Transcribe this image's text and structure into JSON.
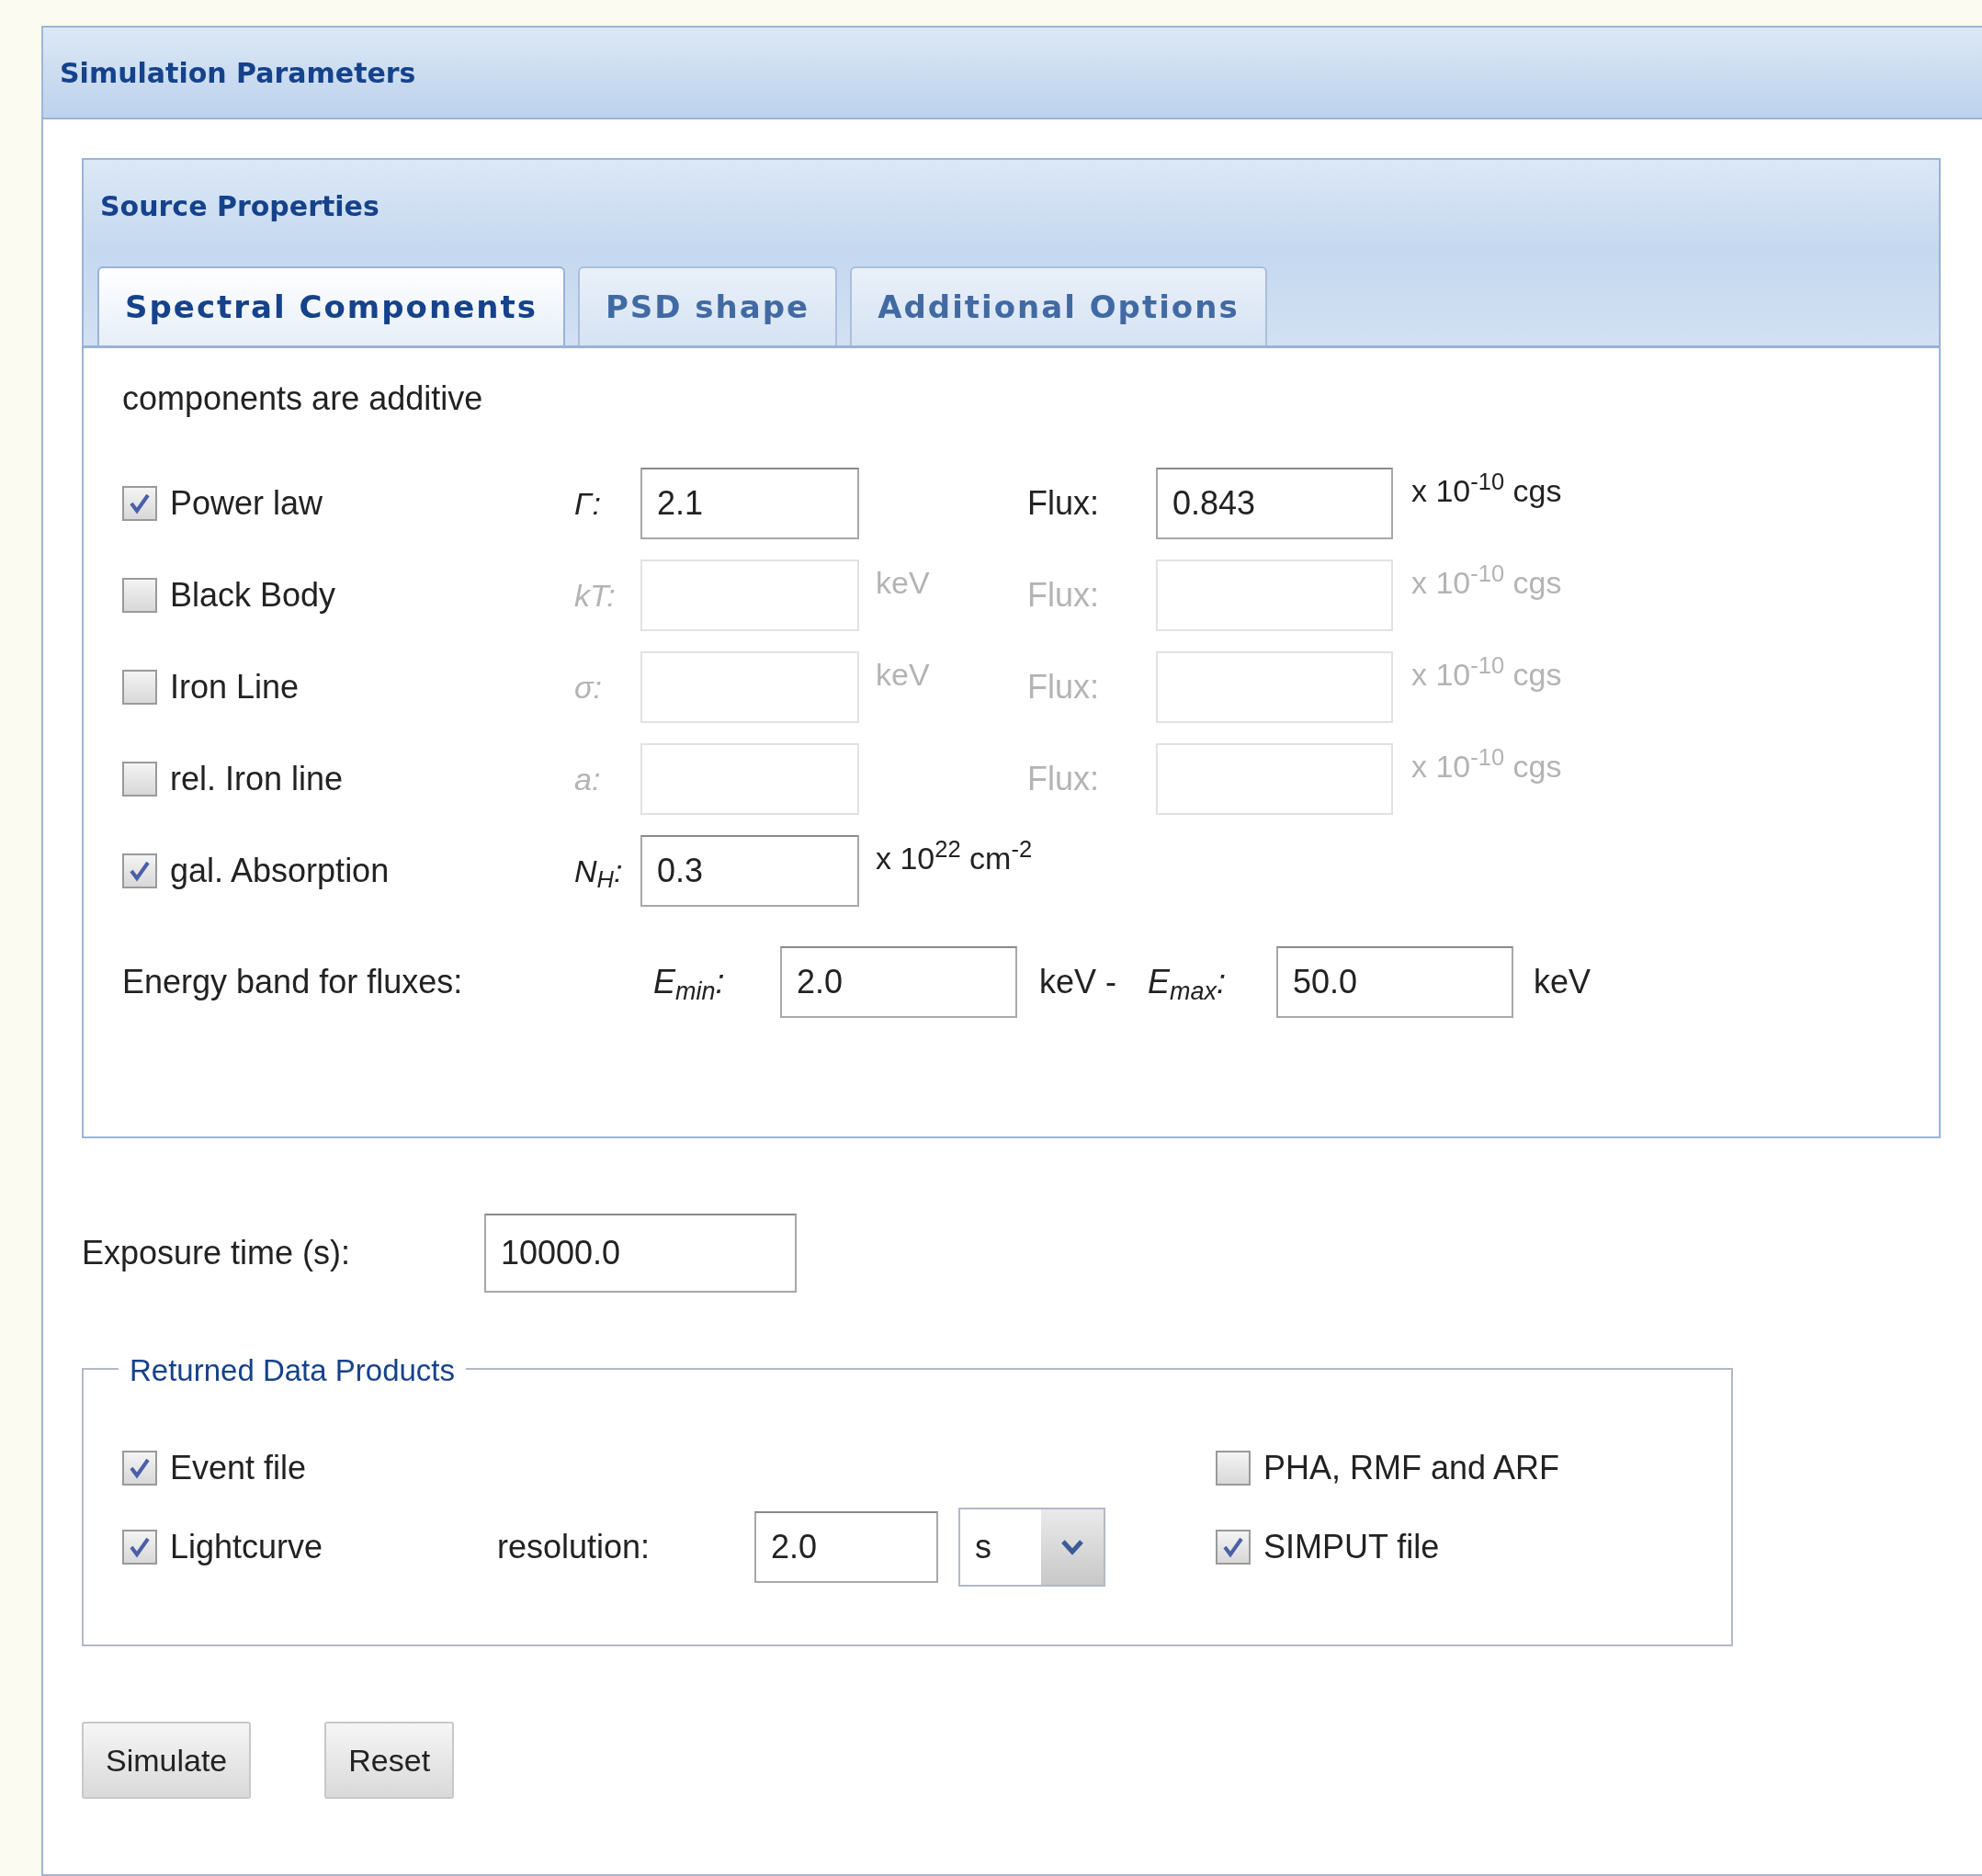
{
  "panel": {
    "title": "Simulation Parameters"
  },
  "source_properties": {
    "title": "Source Properties",
    "tabs": [
      {
        "label": "Spectral Components",
        "selected": true
      },
      {
        "label": "PSD shape",
        "selected": false
      },
      {
        "label": "Additional Options",
        "selected": false
      }
    ],
    "note": "components are additive",
    "components": [
      {
        "label": "Power law",
        "checked": true,
        "param_label": "Γ:",
        "param_value": "2.1",
        "flux": {
          "label": "Flux:",
          "value": "0.843",
          "unit": "x 10$^{-10}$ cgs"
        }
      },
      {
        "label": "Black Body",
        "checked": false,
        "param_label": "kT:",
        "param_unit": "keV",
        "flux": {
          "label": "Flux:",
          "unit": "x 10$^{-10}$ cgs"
        }
      },
      {
        "label": "Iron Line",
        "checked": false,
        "param_label": "σ:",
        "param_unit": "keV",
        "flux": {
          "label": "Flux:",
          "unit": "x 10$^{-10}$ cgs"
        }
      },
      {
        "label": "rel. Iron line",
        "checked": false,
        "param_label": "a:",
        "flux": {
          "label": "Flux:",
          "unit": "x 10$^{-10}$ cgs"
        }
      },
      {
        "label": "gal. Absorption",
        "checked": true,
        "param_label": "N$_{H}$:",
        "param_value": "0.3",
        "param_unit": "x 10$^{22}$ cm$^{-2}$"
      }
    ],
    "energy_band": {
      "label": "Energy band for fluxes:",
      "emin_label": "E$_{min}$:",
      "emin_value": "2.0",
      "separator": "keV -",
      "emax_label": "E$_{max}$:",
      "emax_value": "50.0",
      "unit": "keV"
    }
  },
  "exposure": {
    "label": "Exposure time (s):",
    "value": "10000.0"
  },
  "products": {
    "legend": "Returned Data Products",
    "left": [
      {
        "label": "Event file",
        "checked": true
      },
      {
        "label": "Lightcurve",
        "checked": true,
        "resolution": {
          "label": "resolution:",
          "value": "2.0",
          "unit": "s"
        }
      }
    ],
    "right": [
      {
        "label": "PHA, RMF and ARF",
        "checked": false
      },
      {
        "label": "SIMPUT file",
        "checked": true
      }
    ]
  },
  "buttons": [
    "Simulate",
    "Reset"
  ]
}
